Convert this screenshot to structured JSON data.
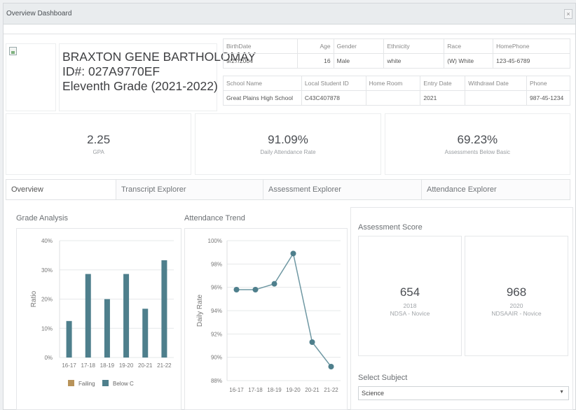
{
  "window": {
    "title": "Overview Dashboard",
    "close_glyph": "×"
  },
  "student": {
    "name": "BRAXTON GENE BARTHOLOMAY",
    "id_line": "ID#: 027A9770EF",
    "grade_line": "Eleventh Grade (2021-2022)",
    "photo_icon": "broken-image-icon"
  },
  "demographics": {
    "headers": [
      "BirthDate",
      "Age",
      "Gender",
      "Ethnicity",
      "Race",
      "HomePhone"
    ],
    "values": [
      "9/27/2004",
      "16",
      "Male",
      "white",
      "(W) White",
      "123-45-6789"
    ]
  },
  "school": {
    "headers": [
      "School Name",
      "Local Student ID",
      "Home Room",
      "Entry Date",
      "Withdrawl Date",
      "Phone"
    ],
    "values": [
      "Great Plains High School",
      "C43C407878",
      "",
      "2021",
      "",
      "987-45-1234"
    ]
  },
  "kpis": [
    {
      "value": "2.25",
      "label": "GPA"
    },
    {
      "value": "91.09%",
      "label": "Daily Attendance Rate"
    },
    {
      "value": "69.23%",
      "label": "Assessments Below Basic"
    }
  ],
  "tabs": [
    "Overview",
    "Transcript Explorer",
    "Assessment Explorer",
    "Attendance Explorer"
  ],
  "panels": {
    "grade_title": "Grade Analysis",
    "attendance_title": "Attendance Trend",
    "assessment_title": "Assessment Score"
  },
  "assessment": {
    "scores": [
      {
        "score": "654",
        "year": "2018",
        "test": "NDSA - Novice"
      },
      {
        "score": "968",
        "year": "2020",
        "test": "NDSAAIR - Novice"
      }
    ],
    "select_label": "Select Subject",
    "select_value": "Science",
    "select_caret": "▼"
  },
  "colors": {
    "failing": "#b8935a",
    "below_c": "#4e7f8c",
    "line": "#6f98a3"
  },
  "chart_data": [
    {
      "type": "bar",
      "title": "",
      "ylabel": "Ratio",
      "categories": [
        "16-17",
        "17-18",
        "18-19",
        "19-20",
        "20-21",
        "21-22"
      ],
      "series": [
        {
          "name": "Failing",
          "values": [
            0,
            0,
            0,
            0,
            0,
            0
          ]
        },
        {
          "name": "Below C",
          "values": [
            12.5,
            28.6,
            20,
            28.6,
            16.7,
            33.3
          ]
        }
      ],
      "ylim": [
        0,
        40
      ],
      "yticks": [
        "0%",
        "10%",
        "20%",
        "30%",
        "40%"
      ],
      "legend": "bottom",
      "grid": true
    },
    {
      "type": "line",
      "title": "",
      "ylabel": "Daily Rate",
      "x": [
        "16-17",
        "17-18",
        "18-19",
        "19-20",
        "20-21",
        "21-22"
      ],
      "values": [
        95.8,
        95.8,
        96.3,
        98.9,
        91.3,
        89.2
      ],
      "ylim": [
        88,
        100
      ],
      "yticks": [
        "88%",
        "90%",
        "92%",
        "94%",
        "96%",
        "98%",
        "100%"
      ],
      "grid": true
    }
  ]
}
